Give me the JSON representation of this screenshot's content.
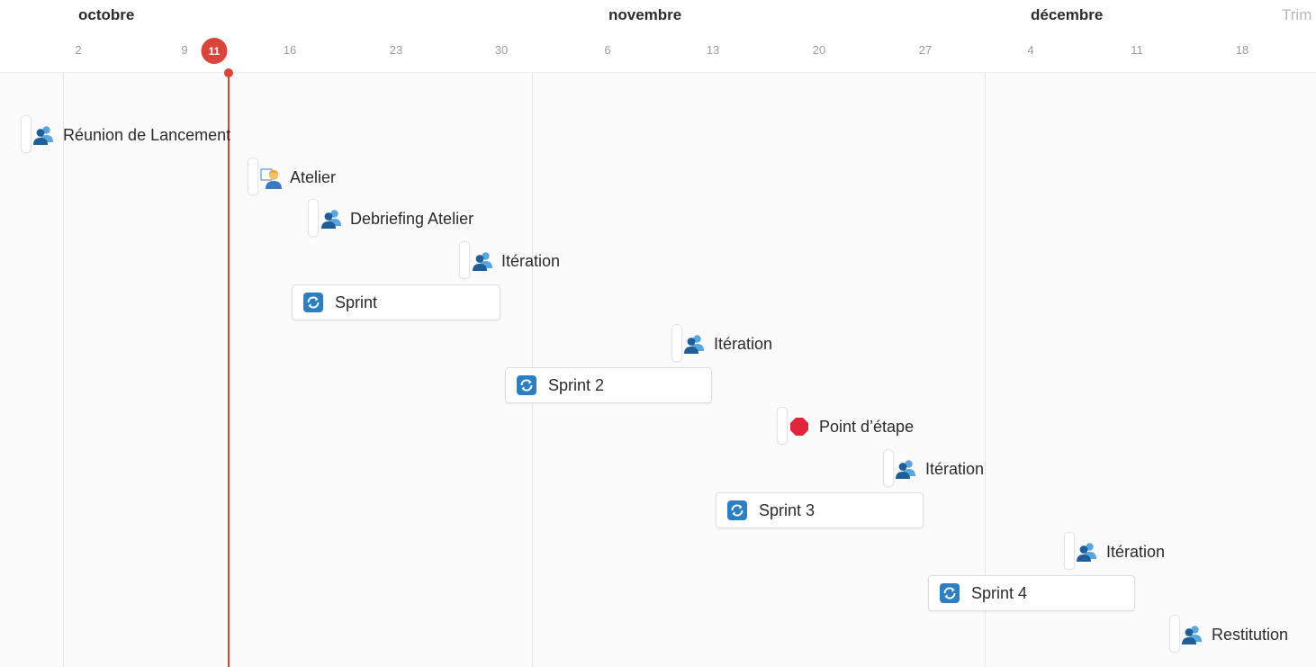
{
  "timeline": {
    "months": [
      "octobre",
      "novembre",
      "décembre",
      "Trim"
    ],
    "days": [
      "2",
      "9",
      "16",
      "23",
      "30",
      "6",
      "13",
      "20",
      "27",
      "4",
      "11",
      "18"
    ],
    "today": "11"
  },
  "colors": {
    "today": "#d9443b",
    "sprint_icon": "#2d7fc1",
    "people_icon": "#1f6fb2",
    "stop_icon": "#e0263b"
  },
  "items": {
    "reunion": {
      "label": "Réunion de Lancement",
      "icon": "people-icon"
    },
    "atelier": {
      "label": "Atelier",
      "icon": "person-at-board-icon"
    },
    "debriefing": {
      "label": "Debriefing Atelier",
      "icon": "people-icon"
    },
    "iteration1": {
      "label": "Itération",
      "icon": "people-icon"
    },
    "sprint1": {
      "label": "Sprint",
      "icon": "cycle-icon"
    },
    "iteration2": {
      "label": "Itération",
      "icon": "people-icon"
    },
    "sprint2": {
      "label": "Sprint 2",
      "icon": "cycle-icon"
    },
    "point_etape": {
      "label": "Point d’étape",
      "icon": "stop-sign-icon"
    },
    "iteration3": {
      "label": "Itération",
      "icon": "people-icon"
    },
    "sprint3": {
      "label": "Sprint 3",
      "icon": "cycle-icon"
    },
    "iteration4": {
      "label": "Itération",
      "icon": "people-icon"
    },
    "sprint4": {
      "label": "Sprint 4",
      "icon": "cycle-icon"
    },
    "restitution": {
      "label": "Restitution",
      "icon": "people-icon"
    }
  }
}
